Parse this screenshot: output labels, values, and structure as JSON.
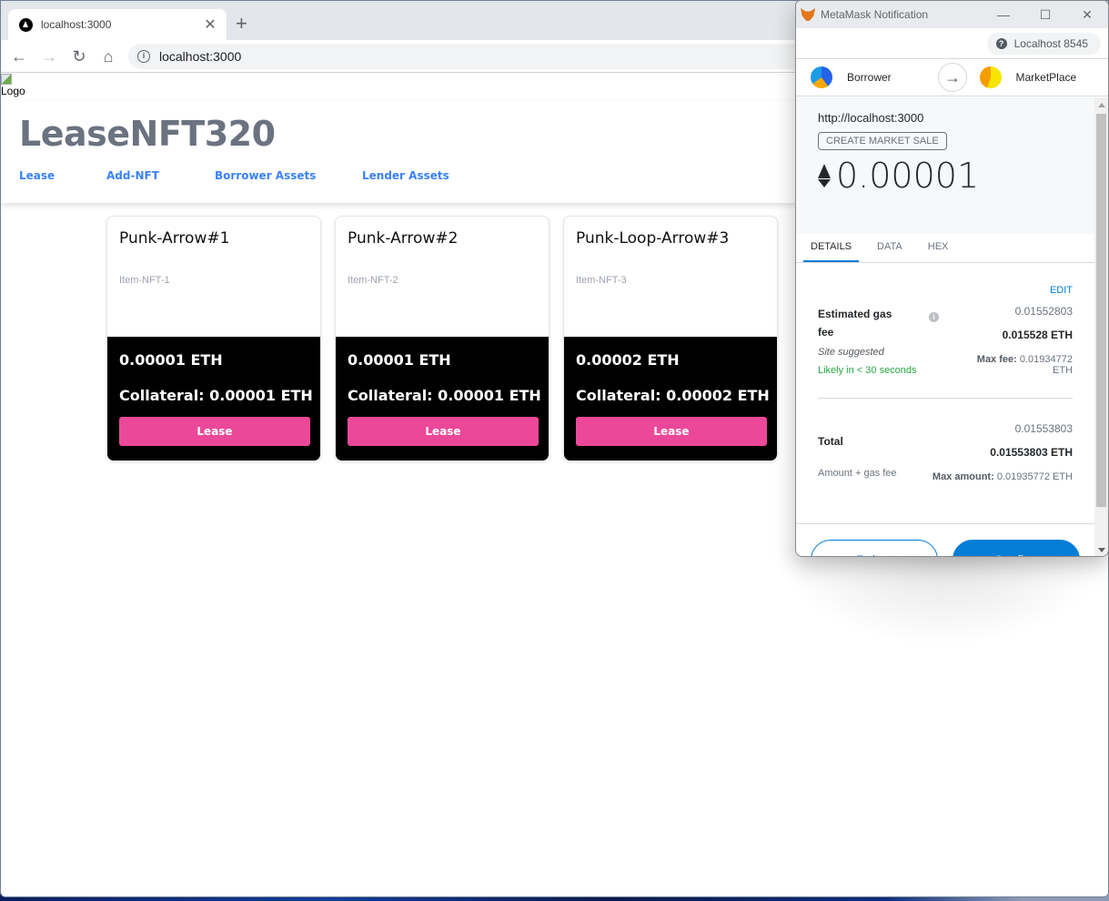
{
  "browser": {
    "tab_title": "localhost:3000",
    "tab_close_icon": "close-icon",
    "new_tab_icon": "plus-icon",
    "url": "localhost:3000",
    "back_icon": "arrow-left-icon",
    "forward_icon": "arrow-right-icon",
    "reload_icon": "reload-icon",
    "home_icon": "home-icon",
    "site_info_icon": "info-icon"
  },
  "page": {
    "logo_alt": "Logo",
    "site_title": "LeaseNFT320",
    "nav": [
      {
        "label": "Lease"
      },
      {
        "label": "Add-NFT"
      },
      {
        "label": "Borrower Assets"
      },
      {
        "label": "Lender Assets"
      }
    ],
    "cards": [
      {
        "name": "Punk-Arrow#1",
        "description": "Item-NFT-1",
        "price": "0.00001 ETH",
        "collateral": "Collateral: 0.00001 ETH",
        "button": "Lease"
      },
      {
        "name": "Punk-Arrow#2",
        "description": "Item-NFT-2",
        "price": "0.00001 ETH",
        "collateral": "Collateral: 0.00001 ETH",
        "button": "Lease"
      },
      {
        "name": "Punk-Loop-Arrow#3",
        "description": "Item-NFT-3",
        "price": "0.00002 ETH",
        "collateral": "Collateral: 0.00002 ETH",
        "button": "Lease"
      }
    ],
    "accent_color": "#ec4899",
    "nav_color": "#3b82f6"
  },
  "metamask": {
    "window_title": "MetaMask Notification",
    "network": "Localhost 8545",
    "from_account": "Borrower",
    "to_account": "MarketPlace",
    "origin": "http://localhost:3000",
    "method": "CREATE MARKET SALE",
    "amount": "0.00001",
    "tabs": [
      {
        "label": "DETAILS",
        "active": true
      },
      {
        "label": "DATA",
        "active": false
      },
      {
        "label": "HEX",
        "active": false
      }
    ],
    "edit_label": "EDIT",
    "gas": {
      "title": "Estimated gas fee",
      "secondary": "0.01552803",
      "primary": "0.015528 ETH",
      "suggestion": "Site suggested",
      "likely": "Likely in < 30 seconds",
      "max_label": "Max fee:",
      "max_value": "0.01934772 ETH"
    },
    "total": {
      "title": "Total",
      "secondary": "0.01553803",
      "primary": "0.01553803 ETH",
      "sub": "Amount + gas fee",
      "max_label": "Max amount:",
      "max_value": "0.01935772 ETH"
    },
    "reject_label": "Reject",
    "confirm_label": "Confirm",
    "primary_color": "#037dd6"
  }
}
